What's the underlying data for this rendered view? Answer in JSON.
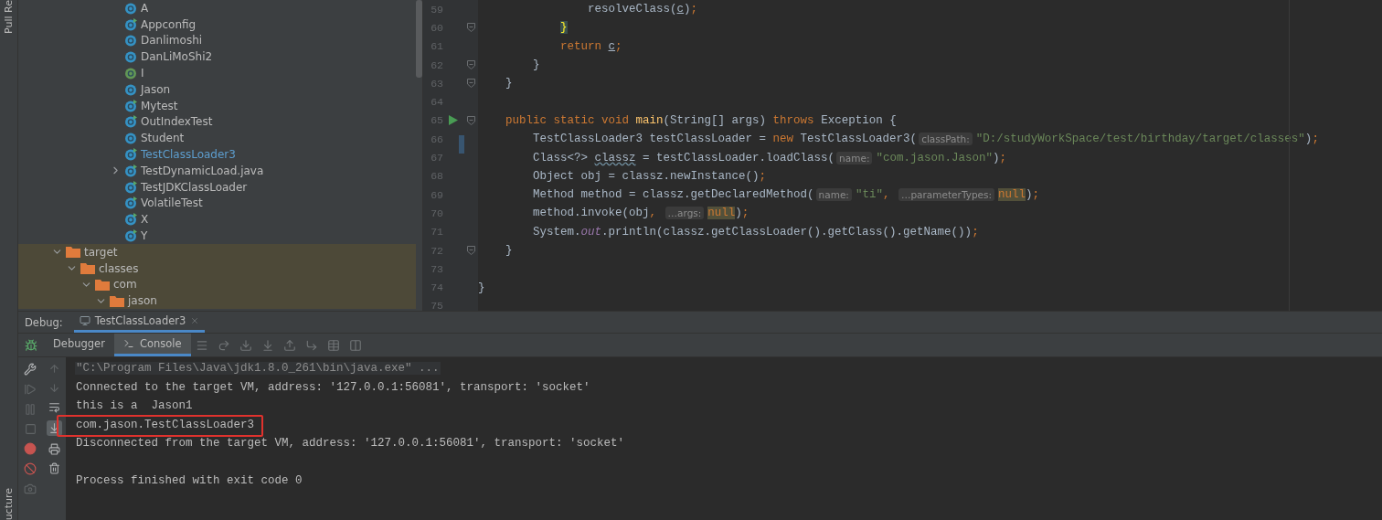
{
  "left_stripe": {
    "top_label": "Pull Re",
    "bottom_label": "ucture"
  },
  "project_tree": {
    "package_children": [
      {
        "label": "A",
        "kind": "class",
        "current": false
      },
      {
        "label": "Appconfig",
        "kind": "runnable",
        "current": false
      },
      {
        "label": "Danlimoshi",
        "kind": "class",
        "current": false
      },
      {
        "label": "DanLiMoShi2",
        "kind": "class",
        "current": false
      },
      {
        "label": "I",
        "kind": "interface",
        "current": false
      },
      {
        "label": "Jason",
        "kind": "class",
        "current": false
      },
      {
        "label": "Mytest",
        "kind": "runnable",
        "current": false
      },
      {
        "label": "OutIndexTest",
        "kind": "runnable",
        "current": false
      },
      {
        "label": "Student",
        "kind": "class",
        "current": false
      },
      {
        "label": "TestClassLoader3",
        "kind": "runnable",
        "current": true
      },
      {
        "label": "TestDynamicLoad.java",
        "kind": "runnable",
        "current": false,
        "expanded": false
      },
      {
        "label": "TestJDKClassLoader",
        "kind": "runnable",
        "current": false
      },
      {
        "label": "VolatileTest",
        "kind": "runnable",
        "current": false
      },
      {
        "label": "X",
        "kind": "runnable",
        "current": false
      },
      {
        "label": "Y",
        "kind": "runnable",
        "current": false
      }
    ],
    "folders": [
      {
        "label": "target",
        "expanded": true,
        "excluded": true,
        "children": [
          {
            "label": "classes",
            "expanded": true,
            "excluded": true,
            "children": [
              {
                "label": "com",
                "expanded": true,
                "excluded": true,
                "children": [
                  {
                    "label": "jason",
                    "expanded": true,
                    "excluded": true
                  }
                ]
              }
            ]
          }
        ]
      }
    ]
  },
  "editor": {
    "lines": [
      {
        "number": "59",
        "fold": false,
        "run": false,
        "changed": false,
        "tokens": [
          {
            "kind": "plain",
            "text": "                resolveClass("
          },
          {
            "kind": "underlined",
            "text": "c"
          },
          {
            "kind": "plain",
            "text": ")"
          },
          {
            "kind": "keyword",
            "text": ";"
          }
        ]
      },
      {
        "number": "60",
        "fold": true,
        "run": false,
        "changed": false,
        "tokens": [
          {
            "kind": "brace-match",
            "text": "            }"
          }
        ]
      },
      {
        "number": "61",
        "fold": false,
        "run": false,
        "changed": false,
        "tokens": [
          {
            "kind": "keyword",
            "text": "            return"
          },
          {
            "kind": "underlined",
            "text": " c"
          },
          {
            "kind": "keyword",
            "text": ";"
          }
        ]
      },
      {
        "number": "62",
        "fold": true,
        "run": false,
        "changed": false,
        "tokens": [
          {
            "kind": "plain",
            "text": "        }"
          }
        ]
      },
      {
        "number": "63",
        "fold": true,
        "run": false,
        "changed": false,
        "tokens": [
          {
            "kind": "plain",
            "text": "    }"
          }
        ]
      },
      {
        "number": "64",
        "fold": false,
        "run": false,
        "changed": false
      },
      {
        "number": "65",
        "fold": true,
        "run": true,
        "changed": false,
        "tokens": [
          {
            "kind": "keyword",
            "text": "    public static void "
          },
          {
            "kind": "method",
            "text": "main"
          },
          {
            "kind": "plain",
            "text": "(String[] args) "
          },
          {
            "kind": "keyword",
            "text": "throws"
          },
          {
            "kind": "plain",
            "text": " Exception {"
          }
        ]
      },
      {
        "number": "66",
        "fold": false,
        "run": false,
        "changed": true,
        "tokens": [
          {
            "kind": "plain",
            "text": "        TestClassLoader3 testClassLoader = "
          },
          {
            "kind": "keyword",
            "text": "new"
          },
          {
            "kind": "plain",
            "text": " TestClassLoader3("
          },
          {
            "kind": "hint",
            "text": "classPath:"
          },
          {
            "kind": "string",
            "text": "\"D:/studyWorkSpace/test/birthday/target/classes\""
          },
          {
            "kind": "plain",
            "text": ")"
          },
          {
            "kind": "keyword",
            "text": ";"
          }
        ]
      },
      {
        "number": "67",
        "fold": false,
        "run": false,
        "changed": false,
        "tokens": [
          {
            "kind": "plain",
            "text": "        Class<?> "
          },
          {
            "kind": "warning",
            "text": "classz"
          },
          {
            "kind": "plain",
            "text": " = testClassLoader.loadClass("
          },
          {
            "kind": "hint",
            "text": "name:"
          },
          {
            "kind": "string",
            "text": "\"com.jason.Jason\""
          },
          {
            "kind": "plain",
            "text": ")"
          },
          {
            "kind": "keyword",
            "text": ";"
          }
        ]
      },
      {
        "number": "68",
        "fold": false,
        "run": false,
        "changed": false,
        "tokens": [
          {
            "kind": "plain",
            "text": "        Object obj = classz.newInstance()"
          },
          {
            "kind": "keyword",
            "text": ";"
          }
        ]
      },
      {
        "number": "69",
        "fold": false,
        "run": false,
        "changed": false,
        "tokens": [
          {
            "kind": "plain",
            "text": "        Method method = classz.getDeclaredMethod("
          },
          {
            "kind": "hint",
            "text": "name:"
          },
          {
            "kind": "string",
            "text": "\"ti\""
          },
          {
            "kind": "keyword",
            "text": ","
          },
          {
            "kind": "hint",
            "text": " …parameterTypes:"
          },
          {
            "kind": "null",
            "text": "null"
          },
          {
            "kind": "plain",
            "text": ")"
          },
          {
            "kind": "keyword",
            "text": ";"
          }
        ]
      },
      {
        "number": "70",
        "fold": false,
        "run": false,
        "changed": false,
        "tokens": [
          {
            "kind": "plain",
            "text": "        method.invoke(obj"
          },
          {
            "kind": "keyword",
            "text": ","
          },
          {
            "kind": "hint",
            "text": " …args:"
          },
          {
            "kind": "null",
            "text": "null"
          },
          {
            "kind": "plain",
            "text": ")"
          },
          {
            "kind": "keyword",
            "text": ";"
          }
        ]
      },
      {
        "number": "71",
        "fold": false,
        "run": false,
        "changed": false,
        "tokens": [
          {
            "kind": "plain",
            "text": "        System."
          },
          {
            "kind": "field",
            "text": "out"
          },
          {
            "kind": "plain",
            "text": ".println(classz.getClassLoader().getClass().getName())"
          },
          {
            "kind": "keyword",
            "text": ";"
          }
        ]
      },
      {
        "number": "72",
        "fold": true,
        "run": false,
        "changed": false,
        "tokens": [
          {
            "kind": "plain",
            "text": "    }"
          }
        ]
      },
      {
        "number": "73",
        "fold": false,
        "run": false,
        "changed": false
      },
      {
        "number": "74",
        "fold": false,
        "run": false,
        "changed": false,
        "tokens": [
          {
            "kind": "plain",
            "text": "}"
          }
        ]
      },
      {
        "number": "75",
        "fold": false,
        "run": false,
        "changed": false
      }
    ]
  },
  "debug": {
    "label": "Debug:",
    "tabs": [
      {
        "label": "TestClassLoader3",
        "selected": true
      }
    ],
    "subtabs": [
      {
        "label": "Debugger",
        "selected": false
      },
      {
        "label": "Console",
        "selected": true
      }
    ],
    "console_lines": [
      {
        "kind": "command",
        "text": "\"C:\\Program Files\\Java\\jdk1.8.0_261\\bin\\java.exe\" ...",
        "boxed": false
      },
      {
        "kind": "output",
        "text": "Connected to the target VM, address: '127.0.0.1:56081', transport: 'socket'",
        "boxed": false
      },
      {
        "kind": "output",
        "text": "this is a  Jason1",
        "boxed": false
      },
      {
        "kind": "output",
        "text": "com.jason.TestClassLoader3",
        "boxed": true
      },
      {
        "kind": "output",
        "text": "Disconnected from the target VM, address: '127.0.0.1:56081', transport: 'socket'",
        "boxed": false
      },
      {
        "kind": "blank",
        "boxed": false
      },
      {
        "kind": "output",
        "text": "Process finished with exit code 0",
        "boxed": false
      }
    ]
  }
}
